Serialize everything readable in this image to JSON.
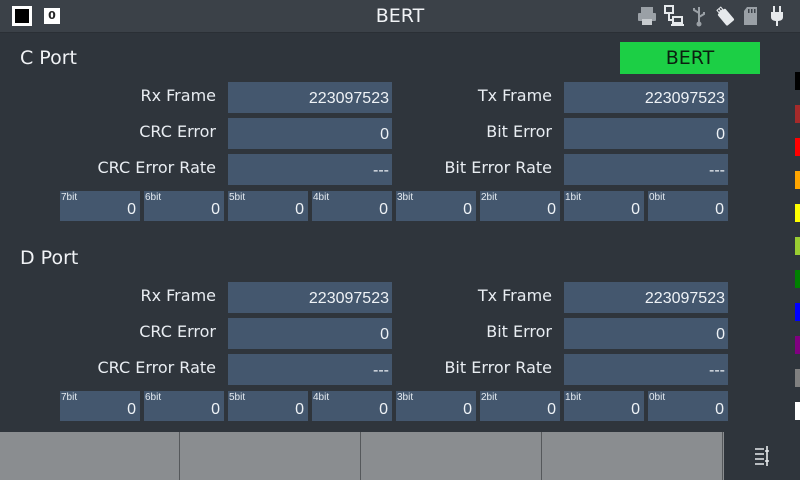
{
  "header": {
    "title": "BERT",
    "zero_badge": "0"
  },
  "status_icons": [
    "printer-icon",
    "network-icon",
    "usb-icon",
    "usb-drive-icon",
    "sd-card-icon",
    "power-plug-icon"
  ],
  "status_indicator": {
    "label": "BERT",
    "color": "#1ccf45"
  },
  "ports": [
    {
      "title": "C Port",
      "rx_frame_label": "Rx Frame",
      "rx_frame": "223097523",
      "tx_frame_label": "Tx Frame",
      "tx_frame": "223097523",
      "crc_error_label": "CRC Error",
      "crc_error": "0",
      "bit_error_label": "Bit Error",
      "bit_error": "0",
      "crc_error_rate_label": "CRC Error Rate",
      "crc_error_rate": "---",
      "bit_error_rate_label": "Bit Error Rate",
      "bit_error_rate": "---",
      "bits": [
        {
          "label": "7bit",
          "value": "0"
        },
        {
          "label": "6bit",
          "value": "0"
        },
        {
          "label": "5bit",
          "value": "0"
        },
        {
          "label": "4bit",
          "value": "0"
        },
        {
          "label": "3bit",
          "value": "0"
        },
        {
          "label": "2bit",
          "value": "0"
        },
        {
          "label": "1bit",
          "value": "0"
        },
        {
          "label": "0bit",
          "value": "0"
        }
      ]
    },
    {
      "title": "D Port",
      "rx_frame_label": "Rx Frame",
      "rx_frame": "223097523",
      "tx_frame_label": "Tx Frame",
      "tx_frame": "223097523",
      "crc_error_label": "CRC Error",
      "crc_error": "0",
      "bit_error_label": "Bit Error",
      "bit_error": "0",
      "crc_error_rate_label": "CRC Error Rate",
      "crc_error_rate": "---",
      "bit_error_rate_label": "Bit Error Rate",
      "bit_error_rate": "---",
      "bits": [
        {
          "label": "7bit",
          "value": "0"
        },
        {
          "label": "6bit",
          "value": "0"
        },
        {
          "label": "5bit",
          "value": "0"
        },
        {
          "label": "4bit",
          "value": "0"
        },
        {
          "label": "3bit",
          "value": "0"
        },
        {
          "label": "2bit",
          "value": "0"
        },
        {
          "label": "1bit",
          "value": "0"
        },
        {
          "label": "0bit",
          "value": "0"
        }
      ]
    }
  ],
  "palette": [
    "#000000",
    "#a52a2a",
    "#ff0000",
    "#ffa500",
    "#ffff00",
    "#9acd32",
    "#008000",
    "#0000ff",
    "#800080",
    "#808080",
    "#ffffff"
  ],
  "softkeys": [
    "",
    "",
    "",
    ""
  ],
  "menu_icon": "menu-settings-icon"
}
